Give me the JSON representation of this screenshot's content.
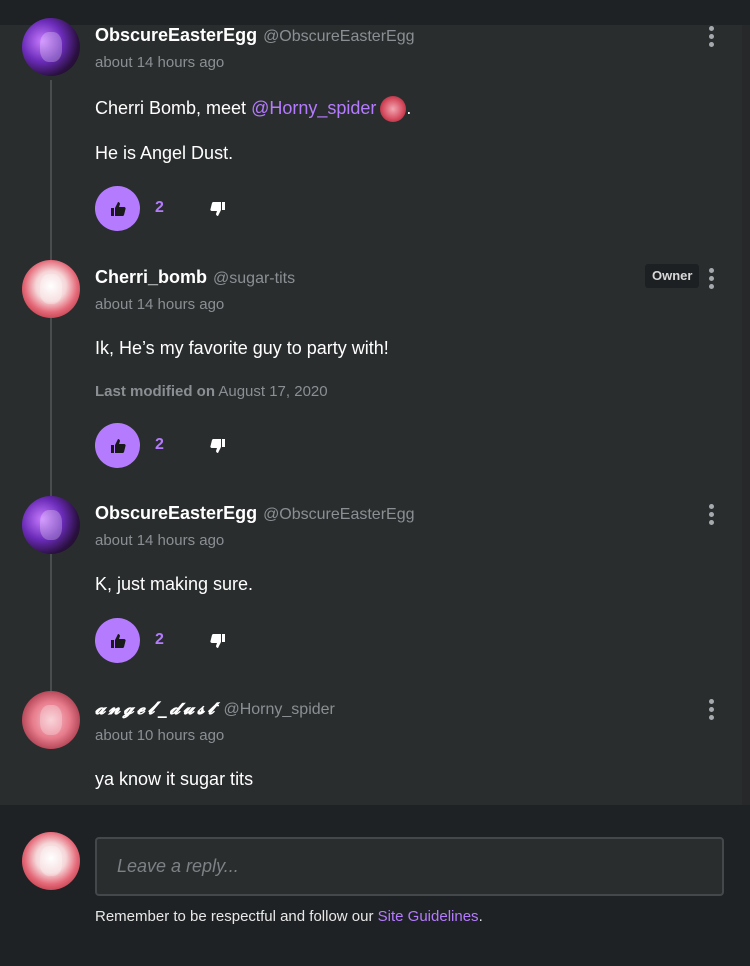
{
  "colors": {
    "accent": "#b57bff",
    "background": "#2a2d2e",
    "muted_text": "#8b8f93"
  },
  "comments": [
    {
      "author": "ObscureEasterEgg",
      "handle": "@ObscureEasterEgg",
      "time": "about 14 hours ago",
      "lines": [
        "Cherri Bomb, meet ",
        "@Horny_spider",
        ".",
        "He is Angel Dust."
      ],
      "likes": "2"
    },
    {
      "author": "Cherri_bomb",
      "handle": "@sugar-tits",
      "badge": "Owner",
      "time": "about 14 hours ago",
      "text": "Ik, He’s my favorite guy to party with!",
      "modified_label": "Last modified on",
      "modified_date": "August 17, 2020",
      "likes": "2"
    },
    {
      "author": "ObscureEasterEgg",
      "handle": "@ObscureEasterEgg",
      "time": "about 14 hours ago",
      "text": "K, just making sure.",
      "likes": "2"
    },
    {
      "author": "𝓪𝓷𝓰𝓮𝓵_𝓭𝓾𝓼𝓽",
      "handle": "@Horny_spider",
      "time": "about 10 hours ago",
      "text": "ya know it sugar tits"
    }
  ],
  "reply": {
    "placeholder": "Leave a reply...",
    "notice_prefix": "Remember to be respectful and follow our ",
    "notice_link": "Site Guidelines",
    "notice_suffix": "."
  }
}
